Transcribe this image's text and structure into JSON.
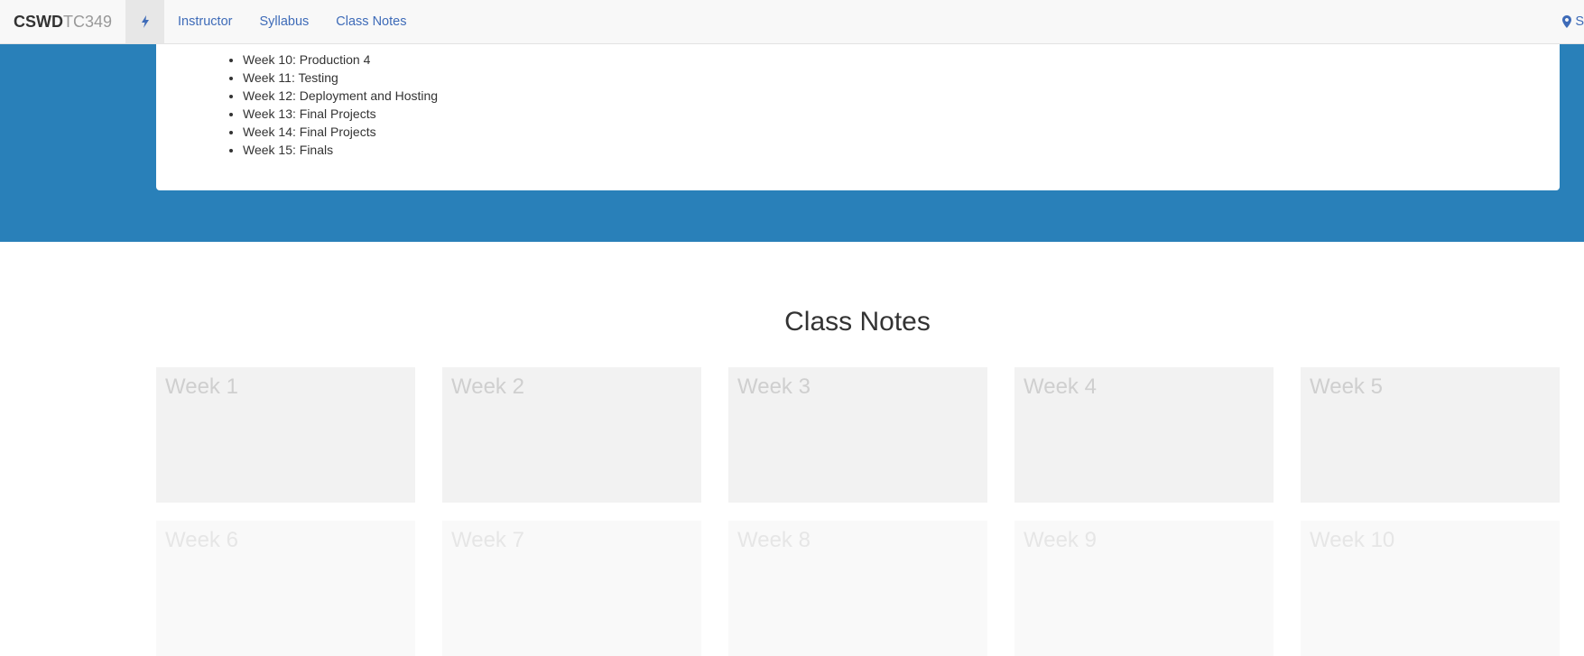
{
  "navbar": {
    "brand_strong": "CSWD",
    "brand_light": "TC349",
    "links": [
      "Instructor",
      "Syllabus",
      "Class Notes"
    ],
    "right_label": "S"
  },
  "syllabus": {
    "weeks": [
      "Week 10: Production 4",
      "Week 11: Testing",
      "Week 12: Deployment and Hosting",
      "Week 13: Final Projects",
      "Week 14: Final Projects",
      "Week 15: Finals"
    ]
  },
  "class_notes": {
    "title": "Class Notes",
    "weeks": [
      "Week 1",
      "Week 2",
      "Week 3",
      "Week 4",
      "Week 5",
      "Week 6",
      "Week 7",
      "Week 8",
      "Week 9",
      "Week 10"
    ]
  },
  "colors": {
    "accent_blue": "#2980b9",
    "link_blue": "#3e6bb8",
    "navbar_bg": "#f8f8f8"
  }
}
